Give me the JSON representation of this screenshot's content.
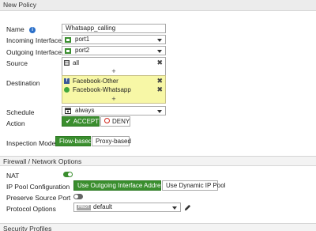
{
  "header": {
    "title": "New Policy"
  },
  "name": {
    "label": "Name",
    "value": "Whatsapp_calling"
  },
  "incoming": {
    "label": "Incoming Interface",
    "value": "port1",
    "icon": "network-port-icon"
  },
  "outgoing": {
    "label": "Outgoing Interface",
    "value": "port2",
    "icon": "network-port-icon"
  },
  "source": {
    "label": "Source",
    "items": [
      {
        "value": "all",
        "icon": "address-object-icon"
      }
    ],
    "add": "+"
  },
  "destination": {
    "label": "Destination",
    "items": [
      {
        "value": "Facebook-Other",
        "icon": "facebook-icon"
      },
      {
        "value": "Facebook-Whatsapp",
        "icon": "whatsapp-icon"
      }
    ],
    "add": "+"
  },
  "schedule": {
    "label": "Schedule",
    "value": "always",
    "icon": "calendar-icon"
  },
  "action": {
    "label": "Action",
    "accept": "ACCEPT",
    "deny": "DENY"
  },
  "inspection": {
    "label": "Inspection Mode",
    "flow": "Flow-based",
    "proxy": "Proxy-based"
  },
  "firewall_section": {
    "title": "Firewall / Network Options"
  },
  "nat": {
    "label": "NAT",
    "enabled": true
  },
  "ippool": {
    "label": "IP Pool Configuration",
    "outgoing": "Use Outgoing Interface Address",
    "dynamic": "Use Dynamic IP Pool"
  },
  "preserve": {
    "label": "Preserve Source Port",
    "enabled": false
  },
  "protocol": {
    "label": "Protocol Options",
    "badge": "PROT",
    "value": "default"
  },
  "security_section": {
    "title": "Security Profiles"
  },
  "colors": {
    "accent_green": "#3a8e2e",
    "destination_bg": "#f7f7a6",
    "info_blue": "#2a6fc9",
    "deny_red": "#d0271d"
  }
}
